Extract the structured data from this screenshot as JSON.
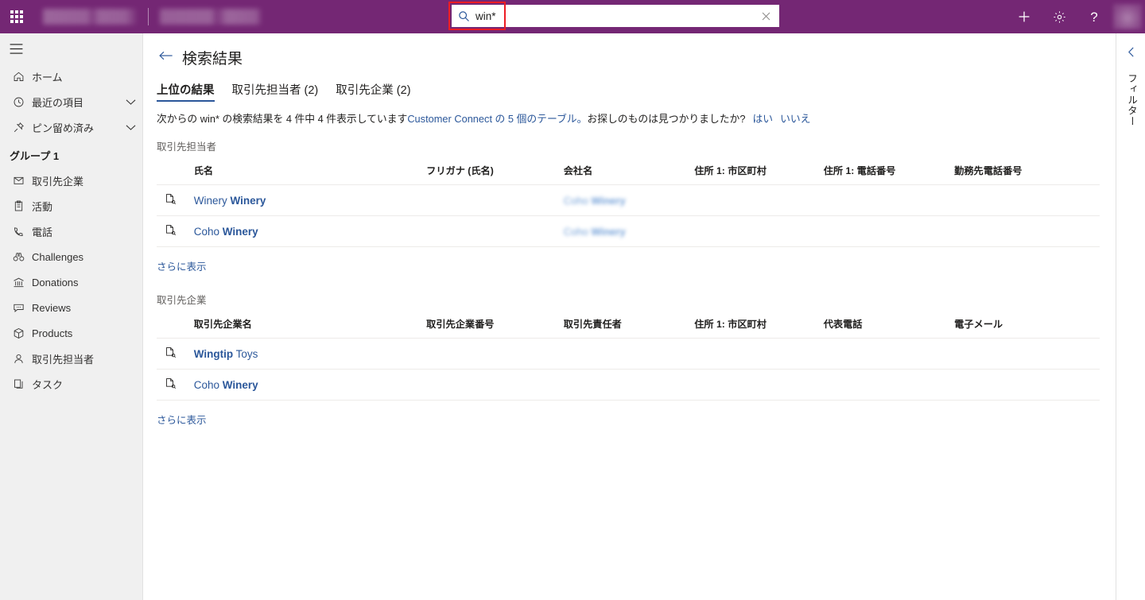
{
  "topbar": {
    "app_launcher": "waffle-icon",
    "brand_redacted": true,
    "search": {
      "value": "win*",
      "placeholder": "",
      "icon": "search-icon",
      "clear_icon": "close-icon",
      "highlight_color": "#ed1c24"
    },
    "actions": [
      {
        "name": "new-button",
        "icon": "plus-icon",
        "glyph": "+"
      },
      {
        "name": "settings-button",
        "icon": "gear-icon",
        "glyph": "⚙"
      },
      {
        "name": "help-button",
        "icon": "question-icon",
        "glyph": "?"
      }
    ],
    "accent_color": "#742774"
  },
  "sidebar": {
    "menu_icon": "hamburger-icon",
    "items": [
      {
        "label": "ホーム",
        "icon": "home-icon",
        "chevron": false
      },
      {
        "label": "最近の項目",
        "icon": "clock-icon",
        "chevron": true
      },
      {
        "label": "ピン留め済み",
        "icon": "pin-icon",
        "chevron": true
      }
    ],
    "group_label": "グループ 1",
    "group_items": [
      {
        "label": "取引先企業",
        "icon": "account-icon"
      },
      {
        "label": "活動",
        "icon": "activity-icon"
      },
      {
        "label": "電話",
        "icon": "phone-icon"
      },
      {
        "label": "Challenges",
        "icon": "binoculars-icon"
      },
      {
        "label": "Donations",
        "icon": "bank-icon"
      },
      {
        "label": "Reviews",
        "icon": "comment-icon"
      },
      {
        "label": "Products",
        "icon": "box-icon"
      },
      {
        "label": "取引先担当者",
        "icon": "contact-icon"
      },
      {
        "label": "タスク",
        "icon": "task-icon"
      }
    ]
  },
  "page": {
    "back_icon": "back-arrow-icon",
    "title": "検索結果",
    "tabs": [
      {
        "label": "上位の結果",
        "count": "",
        "active": true
      },
      {
        "label": "取引先担当者",
        "count": "(2)",
        "active": false
      },
      {
        "label": "取引先企業",
        "count": "(2)",
        "active": false
      }
    ],
    "status": {
      "prefix": "次からの win* の検索結果を 4 件中 4 件表示しています",
      "link": "Customer Connect の 5 個のテーブル。",
      "question": "お探しのものは見つかりましたか?",
      "yes": "はい",
      "no": "いいえ"
    }
  },
  "contacts_section": {
    "title": "取引先担当者",
    "columns": [
      "氏名",
      "フリガナ (氏名)",
      "会社名",
      "住所 1: 市区町村",
      "住所 1: 電話番号",
      "勤務先電話番号"
    ],
    "rows": [
      {
        "icon": "record-icon",
        "name_plain": "Winery ",
        "name_bold": "Winery",
        "furigana": "",
        "company_blurred_plain": "Coho ",
        "company_blurred_bold": "Winery",
        "city": "",
        "phone": "",
        "business_phone": ""
      },
      {
        "icon": "record-icon",
        "name_plain": "Coho ",
        "name_bold": "Winery",
        "furigana": "",
        "company_blurred_plain": "Coho ",
        "company_blurred_bold": "Winery",
        "city": "",
        "phone": "",
        "business_phone": ""
      }
    ],
    "show_more": "さらに表示"
  },
  "accounts_section": {
    "title": "取引先企業",
    "columns": [
      "取引先企業名",
      "取引先企業番号",
      "取引先責任者",
      "住所 1: 市区町村",
      "代表電話",
      "電子メール"
    ],
    "rows": [
      {
        "icon": "record-icon",
        "name_bold": "Wingtip",
        "name_plain": " Toys",
        "number": "",
        "owner": "",
        "city": "",
        "main_phone": "",
        "email": ""
      },
      {
        "icon": "record-icon",
        "name_plain": "Coho ",
        "name_bold": "Winery",
        "number": "",
        "owner": "",
        "city": "",
        "main_phone": "",
        "email": ""
      }
    ],
    "show_more": "さらに表示"
  },
  "filter_rail": {
    "collapse_icon": "chevron-left-icon",
    "label": "フィルター"
  }
}
